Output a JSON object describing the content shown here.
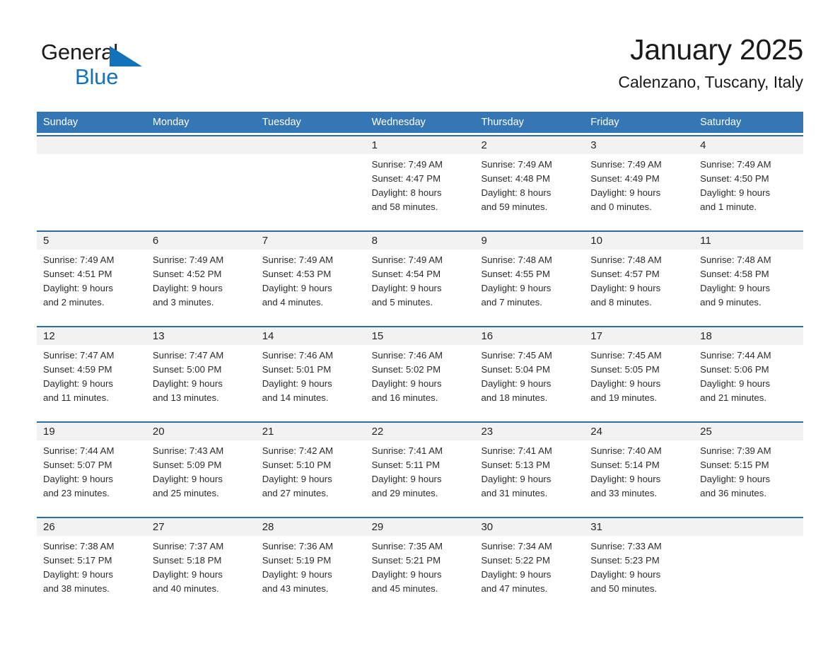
{
  "brand": {
    "name_part1": "General",
    "name_part2": "Blue",
    "triangle_color": "#1273bb",
    "text_color": "#1a1a1a"
  },
  "header": {
    "month_title": "January 2025",
    "location": "Calenzano, Tuscany, Italy"
  },
  "theme": {
    "header_blue": "#3577b5",
    "row_border_blue": "#2e6da4",
    "daynum_band": "#f2f2f2",
    "text": "#2b2b2b"
  },
  "weekdays": [
    "Sunday",
    "Monday",
    "Tuesday",
    "Wednesday",
    "Thursday",
    "Friday",
    "Saturday"
  ],
  "weeks": [
    [
      {
        "day": "",
        "empty": true
      },
      {
        "day": "",
        "empty": true
      },
      {
        "day": "",
        "empty": true
      },
      {
        "day": "1",
        "sunrise": "Sunrise: 7:49 AM",
        "sunset": "Sunset: 4:47 PM",
        "daylight_1": "Daylight: 8 hours",
        "daylight_2": "and 58 minutes."
      },
      {
        "day": "2",
        "sunrise": "Sunrise: 7:49 AM",
        "sunset": "Sunset: 4:48 PM",
        "daylight_1": "Daylight: 8 hours",
        "daylight_2": "and 59 minutes."
      },
      {
        "day": "3",
        "sunrise": "Sunrise: 7:49 AM",
        "sunset": "Sunset: 4:49 PM",
        "daylight_1": "Daylight: 9 hours",
        "daylight_2": "and 0 minutes."
      },
      {
        "day": "4",
        "sunrise": "Sunrise: 7:49 AM",
        "sunset": "Sunset: 4:50 PM",
        "daylight_1": "Daylight: 9 hours",
        "daylight_2": "and 1 minute."
      }
    ],
    [
      {
        "day": "5",
        "sunrise": "Sunrise: 7:49 AM",
        "sunset": "Sunset: 4:51 PM",
        "daylight_1": "Daylight: 9 hours",
        "daylight_2": "and 2 minutes."
      },
      {
        "day": "6",
        "sunrise": "Sunrise: 7:49 AM",
        "sunset": "Sunset: 4:52 PM",
        "daylight_1": "Daylight: 9 hours",
        "daylight_2": "and 3 minutes."
      },
      {
        "day": "7",
        "sunrise": "Sunrise: 7:49 AM",
        "sunset": "Sunset: 4:53 PM",
        "daylight_1": "Daylight: 9 hours",
        "daylight_2": "and 4 minutes."
      },
      {
        "day": "8",
        "sunrise": "Sunrise: 7:49 AM",
        "sunset": "Sunset: 4:54 PM",
        "daylight_1": "Daylight: 9 hours",
        "daylight_2": "and 5 minutes."
      },
      {
        "day": "9",
        "sunrise": "Sunrise: 7:48 AM",
        "sunset": "Sunset: 4:55 PM",
        "daylight_1": "Daylight: 9 hours",
        "daylight_2": "and 7 minutes."
      },
      {
        "day": "10",
        "sunrise": "Sunrise: 7:48 AM",
        "sunset": "Sunset: 4:57 PM",
        "daylight_1": "Daylight: 9 hours",
        "daylight_2": "and 8 minutes."
      },
      {
        "day": "11",
        "sunrise": "Sunrise: 7:48 AM",
        "sunset": "Sunset: 4:58 PM",
        "daylight_1": "Daylight: 9 hours",
        "daylight_2": "and 9 minutes."
      }
    ],
    [
      {
        "day": "12",
        "sunrise": "Sunrise: 7:47 AM",
        "sunset": "Sunset: 4:59 PM",
        "daylight_1": "Daylight: 9 hours",
        "daylight_2": "and 11 minutes."
      },
      {
        "day": "13",
        "sunrise": "Sunrise: 7:47 AM",
        "sunset": "Sunset: 5:00 PM",
        "daylight_1": "Daylight: 9 hours",
        "daylight_2": "and 13 minutes."
      },
      {
        "day": "14",
        "sunrise": "Sunrise: 7:46 AM",
        "sunset": "Sunset: 5:01 PM",
        "daylight_1": "Daylight: 9 hours",
        "daylight_2": "and 14 minutes."
      },
      {
        "day": "15",
        "sunrise": "Sunrise: 7:46 AM",
        "sunset": "Sunset: 5:02 PM",
        "daylight_1": "Daylight: 9 hours",
        "daylight_2": "and 16 minutes."
      },
      {
        "day": "16",
        "sunrise": "Sunrise: 7:45 AM",
        "sunset": "Sunset: 5:04 PM",
        "daylight_1": "Daylight: 9 hours",
        "daylight_2": "and 18 minutes."
      },
      {
        "day": "17",
        "sunrise": "Sunrise: 7:45 AM",
        "sunset": "Sunset: 5:05 PM",
        "daylight_1": "Daylight: 9 hours",
        "daylight_2": "and 19 minutes."
      },
      {
        "day": "18",
        "sunrise": "Sunrise: 7:44 AM",
        "sunset": "Sunset: 5:06 PM",
        "daylight_1": "Daylight: 9 hours",
        "daylight_2": "and 21 minutes."
      }
    ],
    [
      {
        "day": "19",
        "sunrise": "Sunrise: 7:44 AM",
        "sunset": "Sunset: 5:07 PM",
        "daylight_1": "Daylight: 9 hours",
        "daylight_2": "and 23 minutes."
      },
      {
        "day": "20",
        "sunrise": "Sunrise: 7:43 AM",
        "sunset": "Sunset: 5:09 PM",
        "daylight_1": "Daylight: 9 hours",
        "daylight_2": "and 25 minutes."
      },
      {
        "day": "21",
        "sunrise": "Sunrise: 7:42 AM",
        "sunset": "Sunset: 5:10 PM",
        "daylight_1": "Daylight: 9 hours",
        "daylight_2": "and 27 minutes."
      },
      {
        "day": "22",
        "sunrise": "Sunrise: 7:41 AM",
        "sunset": "Sunset: 5:11 PM",
        "daylight_1": "Daylight: 9 hours",
        "daylight_2": "and 29 minutes."
      },
      {
        "day": "23",
        "sunrise": "Sunrise: 7:41 AM",
        "sunset": "Sunset: 5:13 PM",
        "daylight_1": "Daylight: 9 hours",
        "daylight_2": "and 31 minutes."
      },
      {
        "day": "24",
        "sunrise": "Sunrise: 7:40 AM",
        "sunset": "Sunset: 5:14 PM",
        "daylight_1": "Daylight: 9 hours",
        "daylight_2": "and 33 minutes."
      },
      {
        "day": "25",
        "sunrise": "Sunrise: 7:39 AM",
        "sunset": "Sunset: 5:15 PM",
        "daylight_1": "Daylight: 9 hours",
        "daylight_2": "and 36 minutes."
      }
    ],
    [
      {
        "day": "26",
        "sunrise": "Sunrise: 7:38 AM",
        "sunset": "Sunset: 5:17 PM",
        "daylight_1": "Daylight: 9 hours",
        "daylight_2": "and 38 minutes."
      },
      {
        "day": "27",
        "sunrise": "Sunrise: 7:37 AM",
        "sunset": "Sunset: 5:18 PM",
        "daylight_1": "Daylight: 9 hours",
        "daylight_2": "and 40 minutes."
      },
      {
        "day": "28",
        "sunrise": "Sunrise: 7:36 AM",
        "sunset": "Sunset: 5:19 PM",
        "daylight_1": "Daylight: 9 hours",
        "daylight_2": "and 43 minutes."
      },
      {
        "day": "29",
        "sunrise": "Sunrise: 7:35 AM",
        "sunset": "Sunset: 5:21 PM",
        "daylight_1": "Daylight: 9 hours",
        "daylight_2": "and 45 minutes."
      },
      {
        "day": "30",
        "sunrise": "Sunrise: 7:34 AM",
        "sunset": "Sunset: 5:22 PM",
        "daylight_1": "Daylight: 9 hours",
        "daylight_2": "and 47 minutes."
      },
      {
        "day": "31",
        "sunrise": "Sunrise: 7:33 AM",
        "sunset": "Sunset: 5:23 PM",
        "daylight_1": "Daylight: 9 hours",
        "daylight_2": "and 50 minutes."
      },
      {
        "day": "",
        "empty": true
      }
    ]
  ]
}
